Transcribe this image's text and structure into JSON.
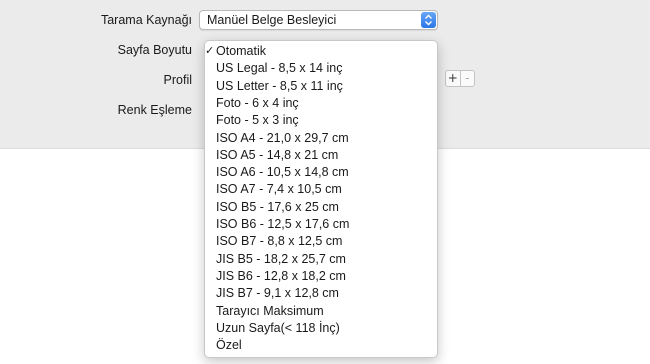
{
  "form": {
    "source_label": "Tarama Kaynağı",
    "source_value": "Manüel Belge Besleyici",
    "page_size_label": "Sayfa Boyutu",
    "profile_label": "Profil",
    "color_match_label": "Renk Eşleme"
  },
  "profile_stepper": {
    "add": "+",
    "remove": "-"
  },
  "page_size_menu": {
    "checkmark": "✓",
    "selected_index": 0,
    "items": [
      "Otomatik",
      "US Legal - 8,5 x 14 inç",
      "US Letter - 8,5 x 11 inç",
      "Foto - 6 x 4 inç",
      "Foto - 5 x 3 inç",
      "ISO A4 - 21,0 x 29,7 cm",
      "ISO A5 - 14,8 x 21 cm",
      "ISO A6 - 10,5 x 14,8 cm",
      "ISO A7 - 7,4 x 10,5 cm",
      "ISO B5 - 17,6 x 25 cm",
      "ISO B6 - 12,5 x 17,6 cm",
      "ISO B7 - 8,8 x 12,5 cm",
      "JIS B5 - 18,2 x 25,7 cm",
      "JIS B6 - 12,8 x 18,2 cm",
      "JIS B7 - 9,1 x 12,8 cm",
      "Tarayıcı Maksimum",
      "Uzun Sayfa(< 118 İnç)",
      "Özel"
    ]
  },
  "colors": {
    "panel_bg": "#ebebeb",
    "accent": "#2a74e8"
  },
  "icons": {
    "popup": "up-down-chevron-icon"
  }
}
